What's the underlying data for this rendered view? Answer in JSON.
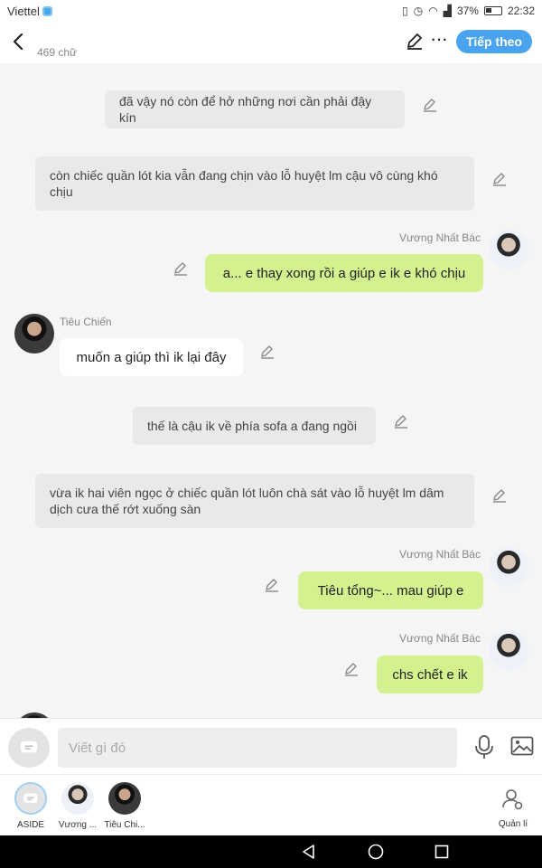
{
  "status_bar": {
    "carrier": "Viettel",
    "battery": "37%",
    "time": "22:32"
  },
  "header": {
    "word_count": "469 chữ",
    "next_label": "Tiếp theo"
  },
  "messages": [
    {
      "type": "narration",
      "text": "đã vậy nó còn để hở những nơi cần phải đậy kín"
    },
    {
      "type": "narration",
      "text": "còn chiếc quần lót kia vẫn đang chịn vào lỗ huyệt lm cậu vô cùng khó chịu"
    },
    {
      "type": "right",
      "name": "Vương Nhất Bác",
      "text": "a... e thay xong rồi a giúp e ik e khó chịu"
    },
    {
      "type": "left",
      "name": "Tiêu Chiến",
      "text": "muốn a giúp thì ik lại đây"
    },
    {
      "type": "narration",
      "text": "thế là cậu ik về phía sofa a đang ngồi"
    },
    {
      "type": "narration",
      "text": "vừa ik hai viên ngọc ở chiếc quần lót luôn chà sát vào lỗ huyệt lm dâm dịch cưa thế rớt xuống sàn"
    },
    {
      "type": "right",
      "name": "Vương Nhất Bác",
      "text": "Tiêu tổng~...  mau giúp e"
    },
    {
      "type": "right",
      "name": "Vương Nhất Bác",
      "text": "chs chết e ik"
    }
  ],
  "input": {
    "placeholder": "Viết gì đó"
  },
  "characters": [
    {
      "label": "ASIDE"
    },
    {
      "label": "Vương ..."
    },
    {
      "label": "Tiêu Chi..."
    }
  ],
  "manage_label": "Quản lí",
  "colors": {
    "accent": "#4aa3ef",
    "right_bubble": "#d4f18f",
    "narration_bg": "#e9e9e9",
    "background": "#f5f5f5"
  }
}
